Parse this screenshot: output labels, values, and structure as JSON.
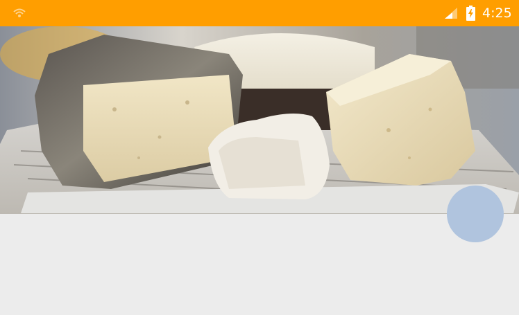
{
  "status_bar": {
    "time": "4:25",
    "background_color": "#FF9E00",
    "icons": [
      "notification-icon",
      "signal-icon",
      "battery-charging-icon"
    ]
  },
  "hero": {
    "image": "cheese-photo",
    "alt": ""
  },
  "fab": {
    "color": "#B0C4DE",
    "icon": ""
  },
  "content": {
    "background_color": "#ECECEC"
  }
}
